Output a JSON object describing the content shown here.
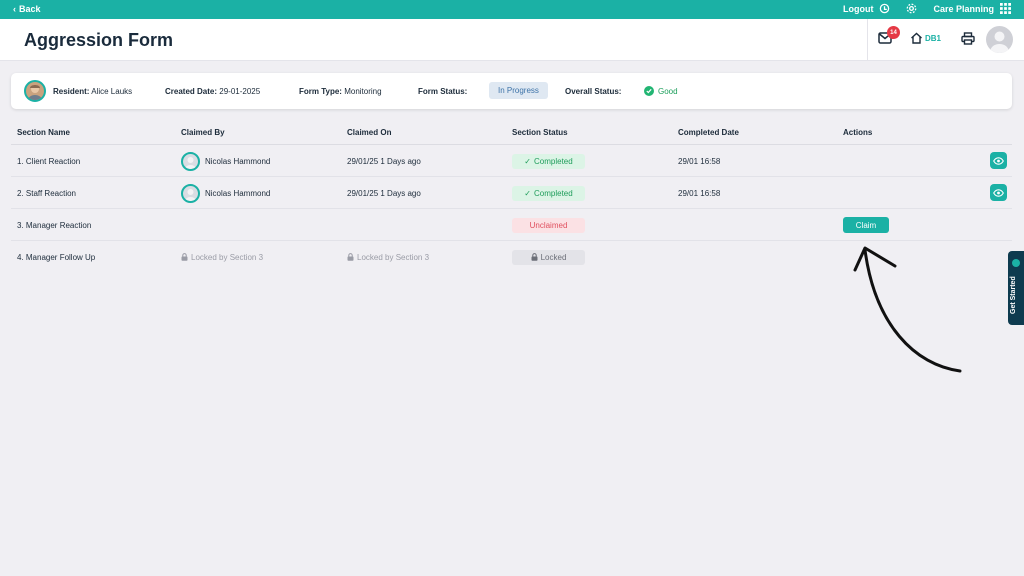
{
  "topbar": {
    "back_label": "Back",
    "logout_label": "Logout",
    "app_label": "Care Planning"
  },
  "header": {
    "title": "Aggression Form",
    "mail_count": "14",
    "home_label": "DB1"
  },
  "info": {
    "resident_label": "Resident:",
    "resident_value": "Alice Lauks",
    "created_label": "Created Date:",
    "created_value": "29-01-2025",
    "type_label": "Form Type:",
    "type_value": "Monitoring",
    "status_label": "Form Status:",
    "status_value": "In Progress",
    "overall_label": "Overall Status:",
    "overall_value": "Good"
  },
  "table": {
    "columns": [
      "Section Name",
      "Claimed By",
      "Claimed On",
      "Section Status",
      "Completed Date",
      "Actions"
    ],
    "rows": [
      {
        "name": "1. Client Reaction",
        "claimed_by": "Nicolas Hammond",
        "claimed_on": "29/01/25 1 Days ago",
        "status": "Completed",
        "completed_date": "29/01 16:58"
      },
      {
        "name": "2. Staff Reaction",
        "claimed_by": "Nicolas Hammond",
        "claimed_on": "29/01/25 1 Days ago",
        "status": "Completed",
        "completed_date": "29/01 16:58"
      },
      {
        "name": "3. Manager Reaction",
        "status": "Unclaimed",
        "action": "Claim"
      },
      {
        "name": "4. Manager Follow Up",
        "claimed_by": "Locked by Section 3",
        "claimed_on": "Locked by Section 3",
        "status": "Locked"
      }
    ]
  },
  "side_tab": {
    "label": "Get Started"
  },
  "colors": {
    "accent": "#1bb1a5",
    "badge": "#e53945",
    "completed": "#1f9d5b",
    "unclaimed": "#e0505f",
    "navy": "#0e3b4f"
  }
}
